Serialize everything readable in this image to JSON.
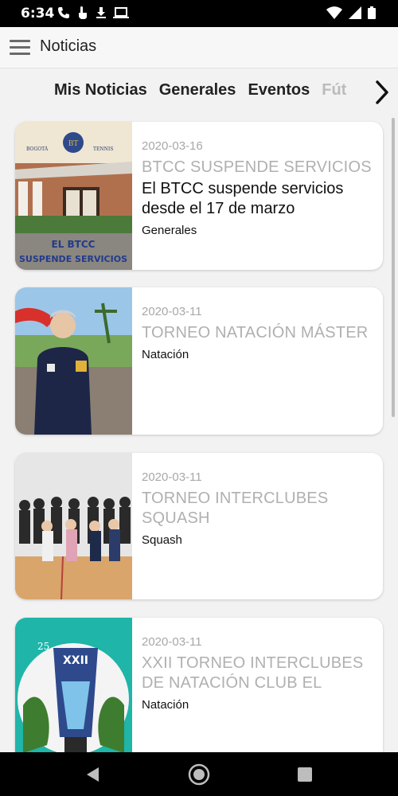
{
  "status_bar": {
    "time": "6:34",
    "left_icons": [
      "phone-icon",
      "touch-icon",
      "download-icon",
      "laptop-icon"
    ],
    "right_icons": [
      "wifi-icon",
      "signal-icon",
      "battery-icon"
    ]
  },
  "app_bar": {
    "menu_icon": "hamburger-menu-icon",
    "title": "Noticias"
  },
  "tabs": [
    {
      "label": "Mis Noticias",
      "selected": true
    },
    {
      "label": "Generales"
    },
    {
      "label": "Eventos"
    },
    {
      "label": "Fút"
    }
  ],
  "tabs_next_icon": "chevron-right-icon",
  "news": [
    {
      "date": "2020-03-16",
      "headline": "BTCC SUSPENDE SERVICIOS",
      "description": "El BTCC suspende servicios desde el 17 de marzo",
      "category": "Generales",
      "thumb": {
        "banner_left": "BOGOTÁ",
        "banner_right": "TENNIS",
        "crest": "BT",
        "overlay_line1": "EL BTCC",
        "overlay_line2": "SUSPENDE SERVICIOS"
      }
    },
    {
      "date": "2020-03-11",
      "headline": "TORNEO NATACIÓN MÁSTER",
      "description": "",
      "category": "Natación"
    },
    {
      "date": "2020-03-11",
      "headline": "TORNEO INTERCLUBES SQUASH",
      "description": "",
      "category": "Squash"
    },
    {
      "date": "2020-03-11",
      "headline": "XXII TORNEO INTERCLUBES DE NATACIÓN CLUB EL",
      "description": "",
      "category": "Natación",
      "thumb": {
        "badge_number": "25",
        "badge_title": "XXII"
      }
    }
  ],
  "colors": {
    "status_bar": "#000000",
    "app_bar": "#f7f7f7",
    "background": "#f2f2f2",
    "headline": "#b0b0b0",
    "date": "#a8a8a8",
    "text": "#111111"
  },
  "nav_bar": {
    "icons": [
      "back-triangle-icon",
      "home-circle-icon",
      "recents-square-icon"
    ]
  }
}
